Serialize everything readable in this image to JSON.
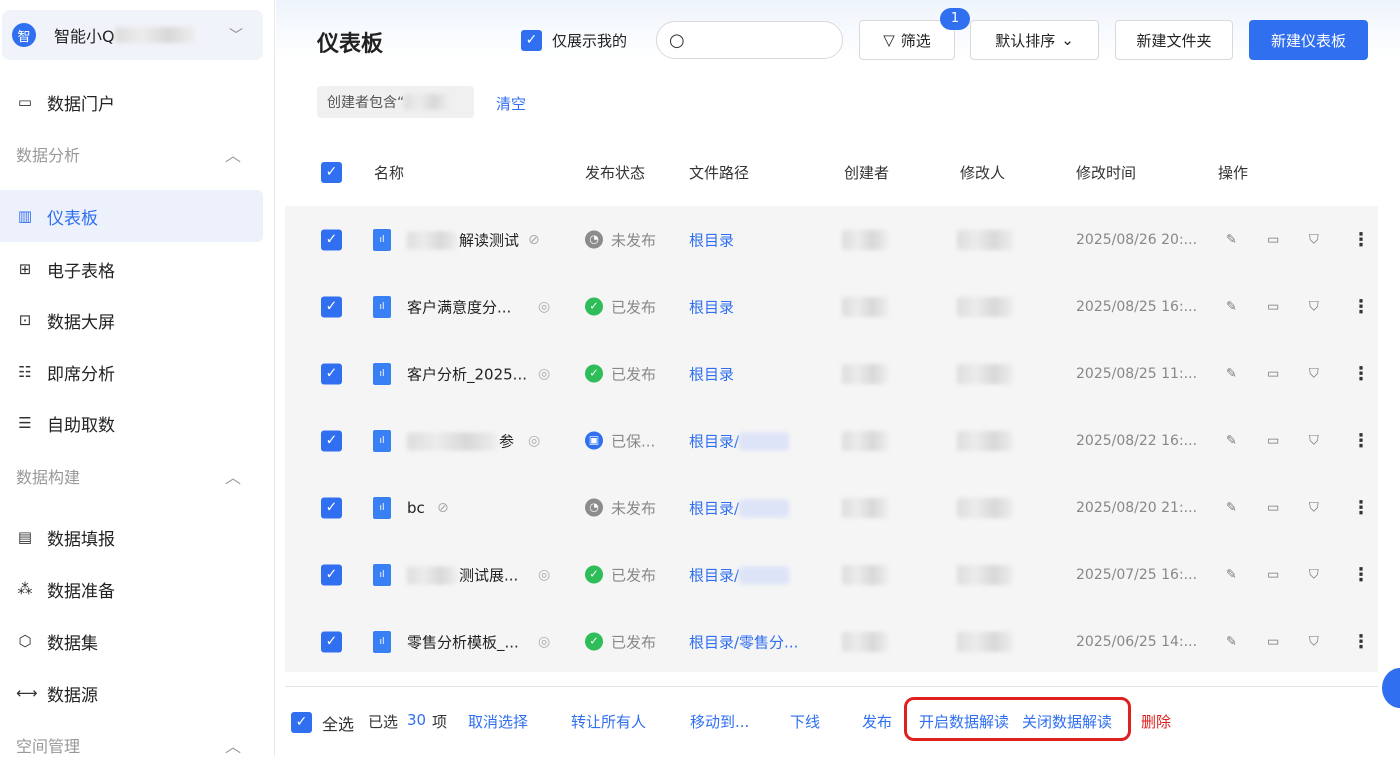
{
  "sidebar": {
    "workspace_logo": "智",
    "workspace_name": "智能小Q",
    "items": [
      {
        "label": "数据门户",
        "icon": "monitor-icon"
      },
      {
        "label": "数据分析",
        "section": true
      },
      {
        "label": "仪表板",
        "icon": "dashboard-icon",
        "active": true
      },
      {
        "label": "电子表格",
        "icon": "table-icon"
      },
      {
        "label": "数据大屏",
        "icon": "chart-screen-icon"
      },
      {
        "label": "即席分析",
        "icon": "adhoc-icon"
      },
      {
        "label": "自助取数",
        "icon": "self-fetch-icon"
      },
      {
        "label": "数据构建",
        "section": true
      },
      {
        "label": "数据填报",
        "icon": "form-icon"
      },
      {
        "label": "数据准备",
        "icon": "prepare-icon"
      },
      {
        "label": "数据集",
        "icon": "cube-icon"
      },
      {
        "label": "数据源",
        "icon": "source-icon"
      },
      {
        "label": "空间管理",
        "section": true
      }
    ]
  },
  "header": {
    "title": "仪表板",
    "only_mine": "仅展示我的",
    "search_placeholder": "",
    "filter": "筛选",
    "filter_badge": "1",
    "sort": "默认排序",
    "new_folder": "新建文件夹",
    "new_dashboard": "新建仪表板"
  },
  "filter_chip": {
    "label": "创建者包含“",
    "clear": "清空"
  },
  "table": {
    "columns": [
      "名称",
      "发布状态",
      "文件路径",
      "创建者",
      "修改人",
      "修改时间",
      "操作"
    ],
    "rows": [
      {
        "name": "解读测试",
        "visible": false,
        "status": "未发布",
        "status_type": "draft",
        "path": "根目录",
        "time": "2025/08/26 20:..."
      },
      {
        "name": "客户满意度分...",
        "visible": true,
        "status": "已发布",
        "status_type": "published",
        "path": "根目录",
        "time": "2025/08/25 16:..."
      },
      {
        "name": "客户分析_2025...",
        "visible": true,
        "status": "已发布",
        "status_type": "published",
        "path": "根目录",
        "time": "2025/08/25 11:..."
      },
      {
        "name": "参",
        "visible": true,
        "status": "已保...",
        "status_type": "saved",
        "path": "根目录/",
        "time": "2025/08/22 16:..."
      },
      {
        "name": "bc",
        "visible": false,
        "status": "未发布",
        "status_type": "draft",
        "path": "根目录/",
        "time": "2025/08/20 21:..."
      },
      {
        "name": "测试展...",
        "visible": true,
        "status": "已发布",
        "status_type": "published",
        "path": "根目录/",
        "time": "2025/07/25 16:..."
      },
      {
        "name": "零售分析模板_...",
        "visible": true,
        "status": "已发布",
        "status_type": "published",
        "path": "根目录/零售分...",
        "time": "2025/06/25 14:..."
      }
    ]
  },
  "footer": {
    "select_all": "全选",
    "selected_prefix": "已选",
    "selected_count": "30",
    "selected_suffix": "项",
    "cancel": "取消选择",
    "transfer": "转让所有人",
    "move": "移动到...",
    "offline": "下线",
    "publish": "发布",
    "enable_interpret": "开启数据解读",
    "disable_interpret": "关闭数据解读",
    "delete": "删除"
  },
  "colors": {
    "accent": "#2f6ff0",
    "published": "#2ebd59",
    "draft": "#8c8c8c",
    "delete": "#e02020"
  }
}
